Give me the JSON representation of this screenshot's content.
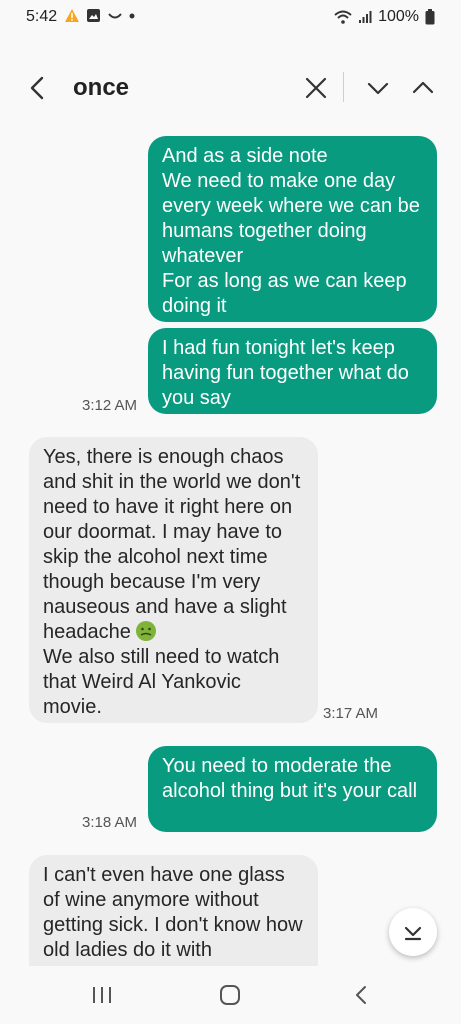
{
  "status_bar": {
    "time": "5:42",
    "battery": "100%"
  },
  "header": {
    "search_term": "once"
  },
  "messages": [
    {
      "type": "sent",
      "text": "And as a side note\nWe need to make one day every week where we can be humans together doing whatever\nFor as long as we can keep doing it"
    },
    {
      "type": "sent",
      "text": "I had fun tonight let's keep having fun together what do you say",
      "time": "3:12 AM"
    },
    {
      "type": "received",
      "text_before_emoji": "Yes, there is enough chaos and shit in the world we don't need to have it right here on our doormat. I may have to skip the alcohol next time though because I'm very nauseous and have a slight headache ",
      "text_after_emoji": "\nWe also still need to watch that Weird Al Yankovic movie.",
      "emoji": "nauseated-face-emoji",
      "time": "3:17 AM"
    },
    {
      "type": "sent",
      "text": "You need to moderate the alcohol thing but it's your call",
      "time": "3:18 AM"
    },
    {
      "type": "received",
      "text": "I can't even have one glass of wine anymore without getting sick. I don't know how old ladies do it with"
    }
  ],
  "icons": {
    "back": "back-arrow-icon",
    "clear": "close-icon",
    "next": "chevron-down-icon",
    "previous": "chevron-up-icon",
    "scroll_bottom": "scroll-to-bottom-icon"
  },
  "colors": {
    "sent_bubble": "#099b80",
    "received_bubble": "#ececec"
  }
}
